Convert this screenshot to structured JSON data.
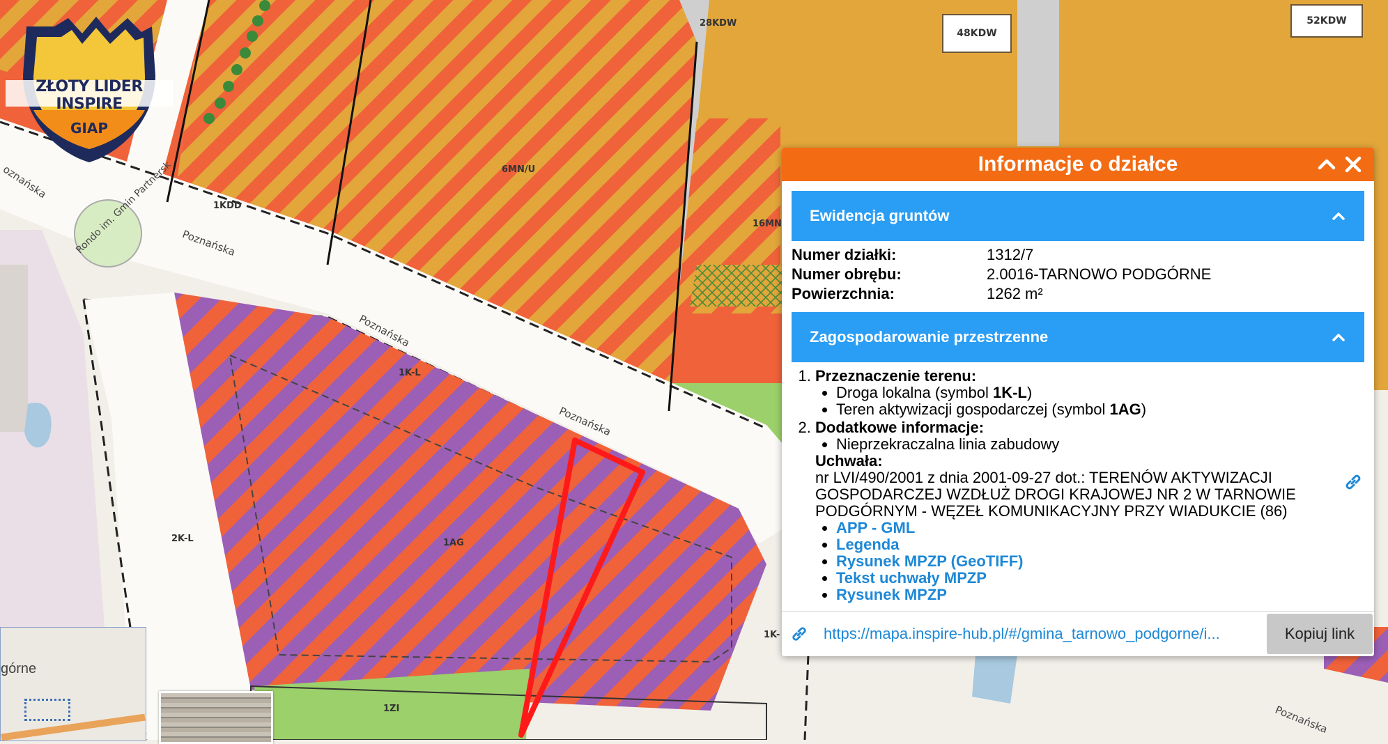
{
  "logo": {
    "title": "ZŁOTY LIDER INSPIRE",
    "subtitle": "GIAP"
  },
  "map": {
    "zone_labels": [
      "6MN/U",
      "1AG",
      "1K-L",
      "2K-L",
      "1KDD",
      "16MN",
      "1ZI",
      "48KDW",
      "52KDW",
      "28KDW",
      "1K-"
    ],
    "street_labels": [
      "Poznańska",
      "Poznańska",
      "Poznańska",
      "Poznańska",
      "oznańska",
      "Rondo im. Gmin Partnersk"
    ],
    "minimap_label": "górne"
  },
  "panel": {
    "title": "Informacje o działce",
    "section1": {
      "title": "Ewidencja gruntów",
      "rows": [
        {
          "key": "Numer działki:",
          "value": "1312/7"
        },
        {
          "key": "Numer obrębu:",
          "value": "2.0016-TARNOWO PODGÓRNE"
        },
        {
          "key": "Powierzchnia:",
          "value": "1262 m²"
        }
      ]
    },
    "section2": {
      "title": "Zagospodarowanie przestrzenne",
      "item1_title": "Przeznaczenie terenu:",
      "item1_a_text": "Droga lokalna (symbol ",
      "item1_a_symbol": "1K-L",
      "item1_b_text": "Teren aktywizacji gospodarczej (symbol ",
      "item1_b_symbol": "1AG",
      "close_paren": ")",
      "item2_title": "Dodatkowe informacje:",
      "item2_a": "Nieprzekraczalna linia zabudowy",
      "uchwala_title": "Uchwała:",
      "uchwala_text": "nr LVI/490/2001 z dnia 2001-09-27 dot.: TERENÓW AKTYWIZACJI GOSPODARCZEJ WZDŁUŻ DROGI KRAJOWEJ NR 2 W TARNOWIE PODGÓRNYM - WĘZEŁ KOMUNIKACYJNY PRZY WIADUKCIE (86)",
      "links": [
        "APP - GML",
        "Legenda",
        "Rysunek MPZP (GeoTIFF)",
        "Tekst uchwały MPZP",
        "Rysunek MPZP"
      ]
    },
    "footer": {
      "url": "https://mapa.inspire-hub.pl/#/gmina_tarnowo_podgorne/i...",
      "copy_label": "Kopiuj link"
    }
  },
  "colors": {
    "header_orange": "#f36b12",
    "section_blue": "#2a9df4",
    "link_blue": "#1e88d6",
    "zone_orange": "#f0623a",
    "zone_purple": "#9b5fb6",
    "zone_yellow": "#e2a63a",
    "zone_green": "#9bd06a",
    "parcel_red": "#ff1a1a"
  }
}
